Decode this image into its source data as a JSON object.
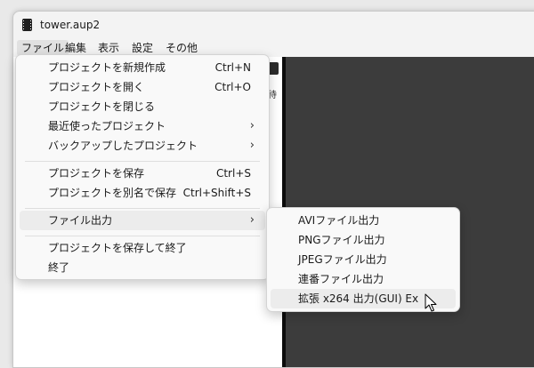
{
  "window": {
    "title": "tower.aup2"
  },
  "menubar": {
    "items": [
      {
        "label": "ファイル"
      },
      {
        "label": "編集"
      },
      {
        "label": "表示"
      },
      {
        "label": "設定"
      },
      {
        "label": "その他"
      }
    ]
  },
  "background": {
    "partial_char": "待"
  },
  "file_menu": {
    "items": [
      {
        "label": "プロジェクトを新規作成",
        "shortcut": "Ctrl+N"
      },
      {
        "label": "プロジェクトを開く",
        "shortcut": "Ctrl+O"
      },
      {
        "label": "プロジェクトを閉じる",
        "shortcut": ""
      },
      {
        "label": "最近使ったプロジェクト",
        "shortcut": ""
      },
      {
        "label": "バックアップしたプロジェクト",
        "shortcut": ""
      },
      {
        "label": "プロジェクトを保存",
        "shortcut": "Ctrl+S"
      },
      {
        "label": "プロジェクトを別名で保存",
        "shortcut": "Ctrl+Shift+S"
      },
      {
        "label": "ファイル出力",
        "shortcut": ""
      },
      {
        "label": "プロジェクトを保存して終了",
        "shortcut": ""
      },
      {
        "label": "終了",
        "shortcut": ""
      }
    ]
  },
  "export_submenu": {
    "items": [
      {
        "label": "AVIファイル出力"
      },
      {
        "label": "PNGファイル出力"
      },
      {
        "label": "JPEGファイル出力"
      },
      {
        "label": "連番ファイル出力"
      },
      {
        "label": "拡張 x264 出力(GUI) Ex"
      }
    ]
  },
  "colors": {
    "menu_bg": "#f9f9f9",
    "highlight": "#ececec",
    "dark_pane": "#3c3c3c",
    "divider": "#0c0c0c"
  },
  "icons": {
    "app": "film-strip-icon",
    "submenu": "chevron-right-icon",
    "pointer": "mouse-pointer-icon"
  }
}
